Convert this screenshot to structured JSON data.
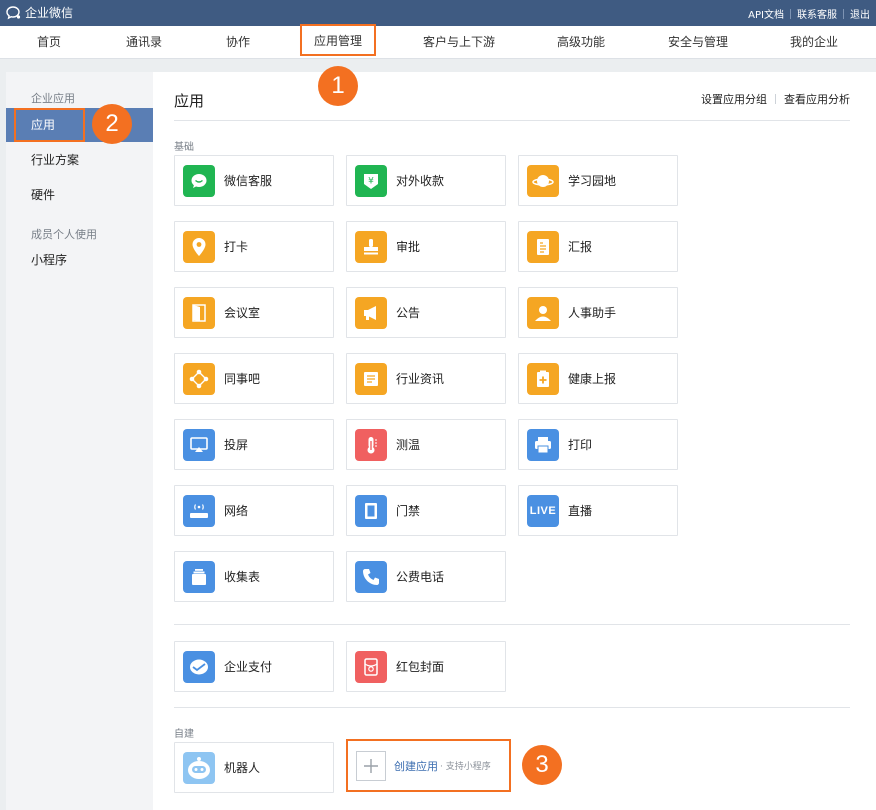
{
  "topbar": {
    "brand": "企业微信",
    "links": [
      "API文档",
      "联系客服",
      "退出"
    ]
  },
  "nav": {
    "items": [
      "首页",
      "通讯录",
      "协作",
      "应用管理",
      "客户与上下游",
      "高级功能",
      "安全与管理",
      "我的企业"
    ],
    "active": "应用管理"
  },
  "sidebar": {
    "group1": "企业应用",
    "items": [
      "应用",
      "行业方案",
      "硬件"
    ],
    "group2": "成员个人使用",
    "items2": [
      "小程序"
    ],
    "active": "应用"
  },
  "main": {
    "title": "应用",
    "links": [
      "设置应用分组",
      "查看应用分析"
    ],
    "section_basic": "基础",
    "basic_apps": [
      {
        "label": "微信客服",
        "icon": "wechat-chat-icon",
        "color": "#20b552"
      },
      {
        "label": "对外收款",
        "icon": "yuan-shield-icon",
        "color": "#20b552"
      },
      {
        "label": "学习园地",
        "icon": "planet-icon",
        "color": "#f5a623"
      },
      {
        "label": "打卡",
        "icon": "location-pin-icon",
        "color": "#f5a623"
      },
      {
        "label": "审批",
        "icon": "stamp-icon",
        "color": "#f5a623"
      },
      {
        "label": "汇报",
        "icon": "report-icon",
        "color": "#f5a623"
      },
      {
        "label": "会议室",
        "icon": "door-icon",
        "color": "#f5a623"
      },
      {
        "label": "公告",
        "icon": "megaphone-icon",
        "color": "#f5a623"
      },
      {
        "label": "人事助手",
        "icon": "person-icon",
        "color": "#f5a623"
      },
      {
        "label": "同事吧",
        "icon": "network-icon",
        "color": "#f5a623"
      },
      {
        "label": "行业资讯",
        "icon": "news-icon",
        "color": "#f5a623"
      },
      {
        "label": "健康上报",
        "icon": "health-icon",
        "color": "#f5a623"
      },
      {
        "label": "投屏",
        "icon": "screen-cast-icon",
        "color": "#4a90e2"
      },
      {
        "label": "测温",
        "icon": "thermometer-icon",
        "color": "#f06060"
      },
      {
        "label": "打印",
        "icon": "printer-icon",
        "color": "#4a90e2"
      },
      {
        "label": "网络",
        "icon": "router-icon",
        "color": "#4a90e2"
      },
      {
        "label": "门禁",
        "icon": "access-door-icon",
        "color": "#4a90e2"
      },
      {
        "label": "直播",
        "icon": "live-icon",
        "color": "#4a90e2",
        "text": "LIVE"
      },
      {
        "label": "收集表",
        "icon": "collect-form-icon",
        "color": "#4a90e2"
      },
      {
        "label": "公费电话",
        "icon": "phone-icon",
        "color": "#4a90e2"
      }
    ],
    "pay_apps": [
      {
        "label": "企业支付",
        "icon": "payment-icon",
        "color": "#4a90e2"
      },
      {
        "label": "红包封面",
        "icon": "red-packet-icon",
        "color": "#f06060"
      }
    ],
    "section_custom": "自建",
    "custom_apps": [
      {
        "label": "机器人",
        "icon": "robot-icon",
        "color": "#8ec5f2"
      }
    ],
    "create": {
      "label": "创建应用",
      "sub": "· 支持小程序"
    }
  },
  "badges": [
    "1",
    "2",
    "3"
  ]
}
